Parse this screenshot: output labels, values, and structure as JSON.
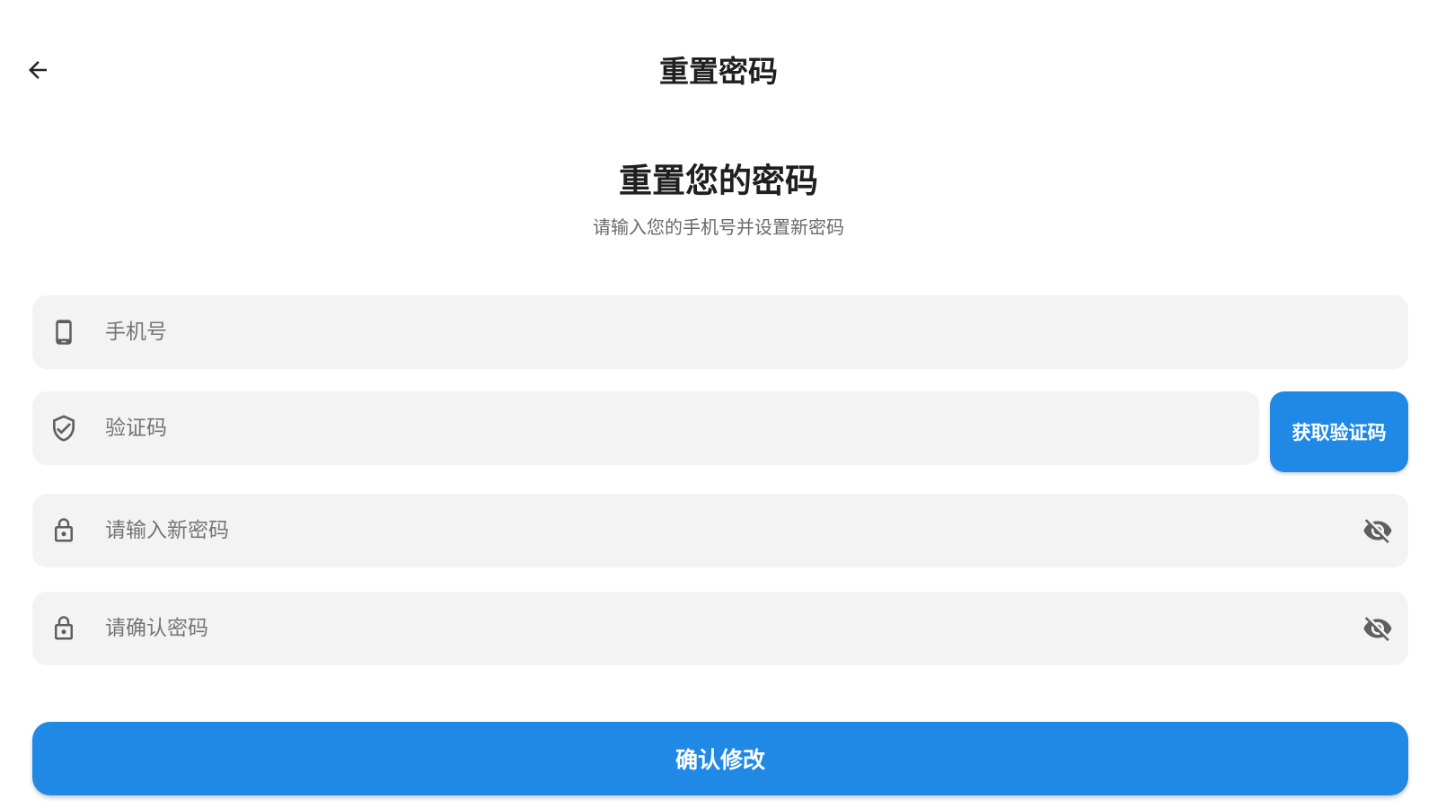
{
  "header": {
    "back_icon": "arrow-back-icon",
    "title": "重置密码"
  },
  "main": {
    "headline": "重置您的密码",
    "subtitle": "请输入您的手机号并设置新密码"
  },
  "form": {
    "phone": {
      "icon": "phone-icon",
      "placeholder": "手机号"
    },
    "code": {
      "icon": "shield-check-icon",
      "placeholder": "验证码",
      "get_code_label": "获取验证码"
    },
    "new_password": {
      "icon": "lock-icon",
      "placeholder": "请输入新密码",
      "visibility_icon": "eye-off-icon"
    },
    "confirm_password": {
      "icon": "lock-icon",
      "placeholder": "请确认密码",
      "visibility_icon": "eye-off-icon"
    },
    "submit_label": "确认修改"
  },
  "colors": {
    "accent": "#1f89e5",
    "field_background": "#f3f3f3",
    "placeholder_text": "#6f6f6f"
  }
}
